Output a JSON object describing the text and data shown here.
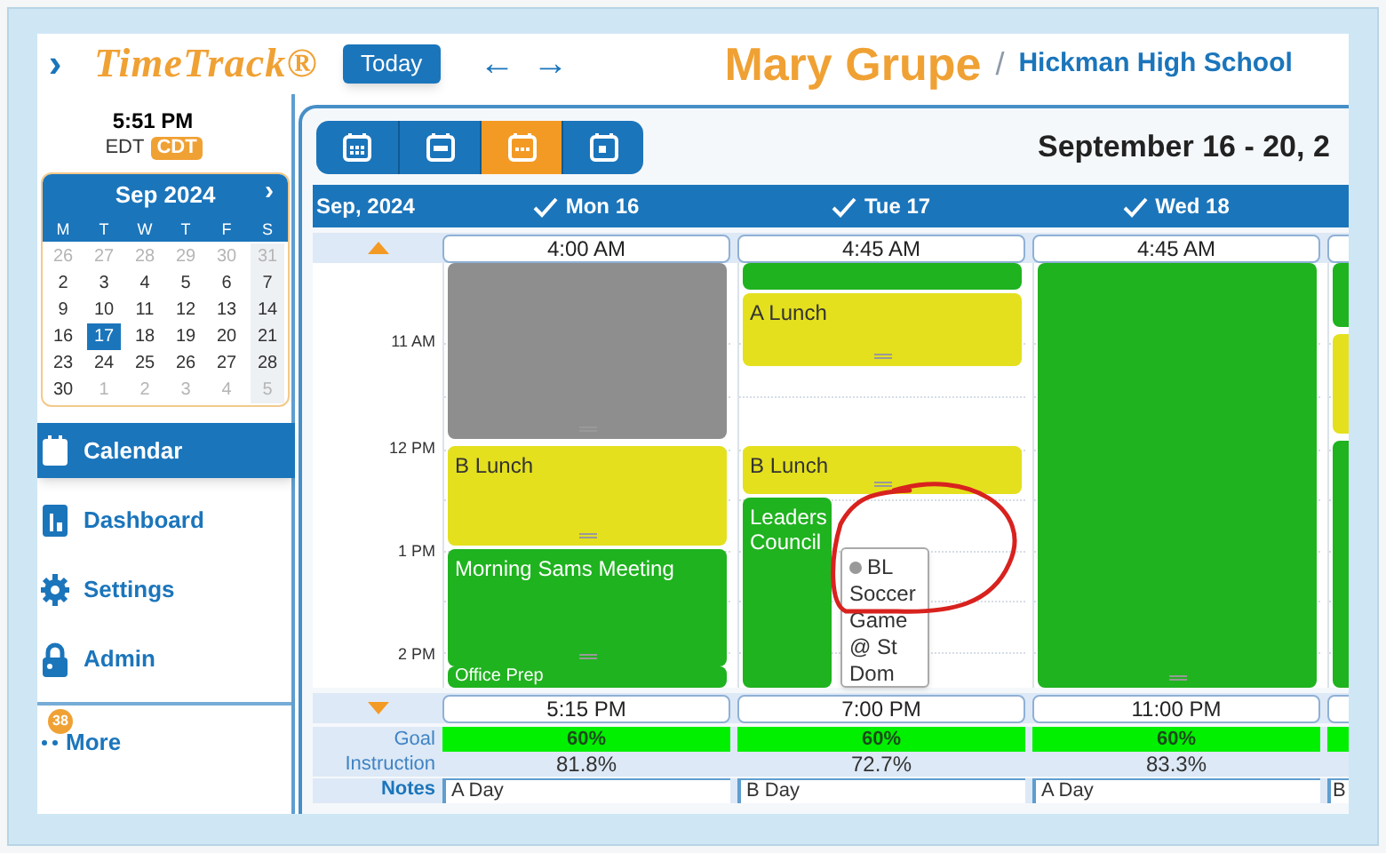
{
  "header": {
    "menu": "›",
    "logo": "TimeTrack®",
    "today_button": "Today",
    "prev": "←",
    "next": "→",
    "user_name": "Mary Grupe",
    "separator": "/",
    "school": "Hickman High School"
  },
  "clock": {
    "time": "5:51 PM",
    "zones": [
      {
        "label": "EDT",
        "selected": false
      },
      {
        "label": "CDT",
        "selected": true
      }
    ]
  },
  "mini_calendar": {
    "title": "Sep 2024",
    "next": "›",
    "weekdays": [
      "M",
      "T",
      "W",
      "T",
      "F",
      "S"
    ],
    "weeks": [
      [
        {
          "day": "26",
          "muted": true,
          "selected": false
        },
        {
          "day": "27",
          "muted": true,
          "selected": false
        },
        {
          "day": "28",
          "muted": true,
          "selected": false
        },
        {
          "day": "29",
          "muted": true,
          "selected": false
        },
        {
          "day": "30",
          "muted": true,
          "selected": false
        },
        {
          "day": "31",
          "muted": true,
          "selected": false
        }
      ],
      [
        {
          "day": "2",
          "muted": false,
          "selected": false
        },
        {
          "day": "3",
          "muted": false,
          "selected": false
        },
        {
          "day": "4",
          "muted": false,
          "selected": false
        },
        {
          "day": "5",
          "muted": false,
          "selected": false
        },
        {
          "day": "6",
          "muted": false,
          "selected": false
        },
        {
          "day": "7",
          "muted": false,
          "selected": false
        }
      ],
      [
        {
          "day": "9",
          "muted": false,
          "selected": false
        },
        {
          "day": "10",
          "muted": false,
          "selected": false
        },
        {
          "day": "11",
          "muted": false,
          "selected": false
        },
        {
          "day": "12",
          "muted": false,
          "selected": false
        },
        {
          "day": "13",
          "muted": false,
          "selected": false
        },
        {
          "day": "14",
          "muted": false,
          "selected": false
        }
      ],
      [
        {
          "day": "16",
          "muted": false,
          "selected": false
        },
        {
          "day": "17",
          "muted": false,
          "selected": true
        },
        {
          "day": "18",
          "muted": false,
          "selected": false
        },
        {
          "day": "19",
          "muted": false,
          "selected": false
        },
        {
          "day": "20",
          "muted": false,
          "selected": false
        },
        {
          "day": "21",
          "muted": false,
          "selected": false
        }
      ],
      [
        {
          "day": "23",
          "muted": false,
          "selected": false
        },
        {
          "day": "24",
          "muted": false,
          "selected": false
        },
        {
          "day": "25",
          "muted": false,
          "selected": false
        },
        {
          "day": "26",
          "muted": false,
          "selected": false
        },
        {
          "day": "27",
          "muted": false,
          "selected": false
        },
        {
          "day": "28",
          "muted": false,
          "selected": false
        }
      ],
      [
        {
          "day": "30",
          "muted": false,
          "selected": false
        },
        {
          "day": "1",
          "muted": true,
          "selected": false
        },
        {
          "day": "2",
          "muted": true,
          "selected": false
        },
        {
          "day": "3",
          "muted": true,
          "selected": false
        },
        {
          "day": "4",
          "muted": true,
          "selected": false
        },
        {
          "day": "5",
          "muted": true,
          "selected": false
        }
      ]
    ]
  },
  "nav": [
    {
      "label": "Calendar",
      "kind": "calendar",
      "selected": true
    },
    {
      "label": "Dashboard",
      "kind": "dashboard",
      "selected": false
    },
    {
      "label": "Settings",
      "kind": "settings",
      "selected": false
    },
    {
      "label": "Admin",
      "kind": "admin",
      "selected": false
    }
  ],
  "more": {
    "label": "More",
    "badge": "38"
  },
  "calendar": {
    "views": [
      {
        "kind": "month",
        "selected": false
      },
      {
        "kind": "week",
        "selected": false
      },
      {
        "kind": "workweek",
        "selected": true
      },
      {
        "kind": "day",
        "selected": false
      }
    ],
    "range": "September 16 - 20, 2",
    "month_label": "Sep, 2024",
    "hours": [
      "11 AM",
      "12 PM",
      "1 PM",
      "2 PM"
    ],
    "goal_label": "Goal",
    "instruction_label": "Instruction",
    "notes_label": "Notes",
    "days": [
      {
        "label": "Mon 16",
        "checked": true,
        "start": "4:00 AM",
        "end": "5:15 PM",
        "goal": "60%",
        "instruction": "81.8%",
        "note": "A Day",
        "events": [
          {
            "color": "#8e8e8e"
          },
          {
            "title": "B Lunch",
            "color": "#e4e01e"
          },
          {
            "title": "Morning Sams Meeting",
            "color": "#1fb31f"
          },
          {
            "title": "Office Prep",
            "color": "#1fb31f"
          }
        ]
      },
      {
        "label": "Tue 17",
        "checked": true,
        "start": "4:45 AM",
        "end": "7:00 PM",
        "goal": "60%",
        "instruction": "72.7%",
        "note": "B Day",
        "events": [
          {
            "color": "#1fb31f"
          },
          {
            "title": "A Lunch",
            "color": "#e4e01e"
          },
          {
            "title": "B Lunch",
            "color": "#e4e01e"
          },
          {
            "title": "Leaders Council",
            "color": "#1fb31f"
          }
        ],
        "popup": {
          "title": "BL Soccer Game @ St Dom"
        }
      },
      {
        "label": "Wed 18",
        "checked": true,
        "start": "4:45 AM",
        "end": "11:00 PM",
        "goal": "60%",
        "instruction": "83.3%",
        "note": "A Day",
        "events": [
          {
            "color": "#1fb31f"
          }
        ]
      },
      {
        "note": "B",
        "events": [
          {
            "color": "#1fb31f"
          },
          {
            "color": "#e4e01e"
          },
          {
            "color": "#1fb31f"
          }
        ]
      }
    ]
  },
  "annotations": [
    {
      "kind": "circle"
    }
  ]
}
